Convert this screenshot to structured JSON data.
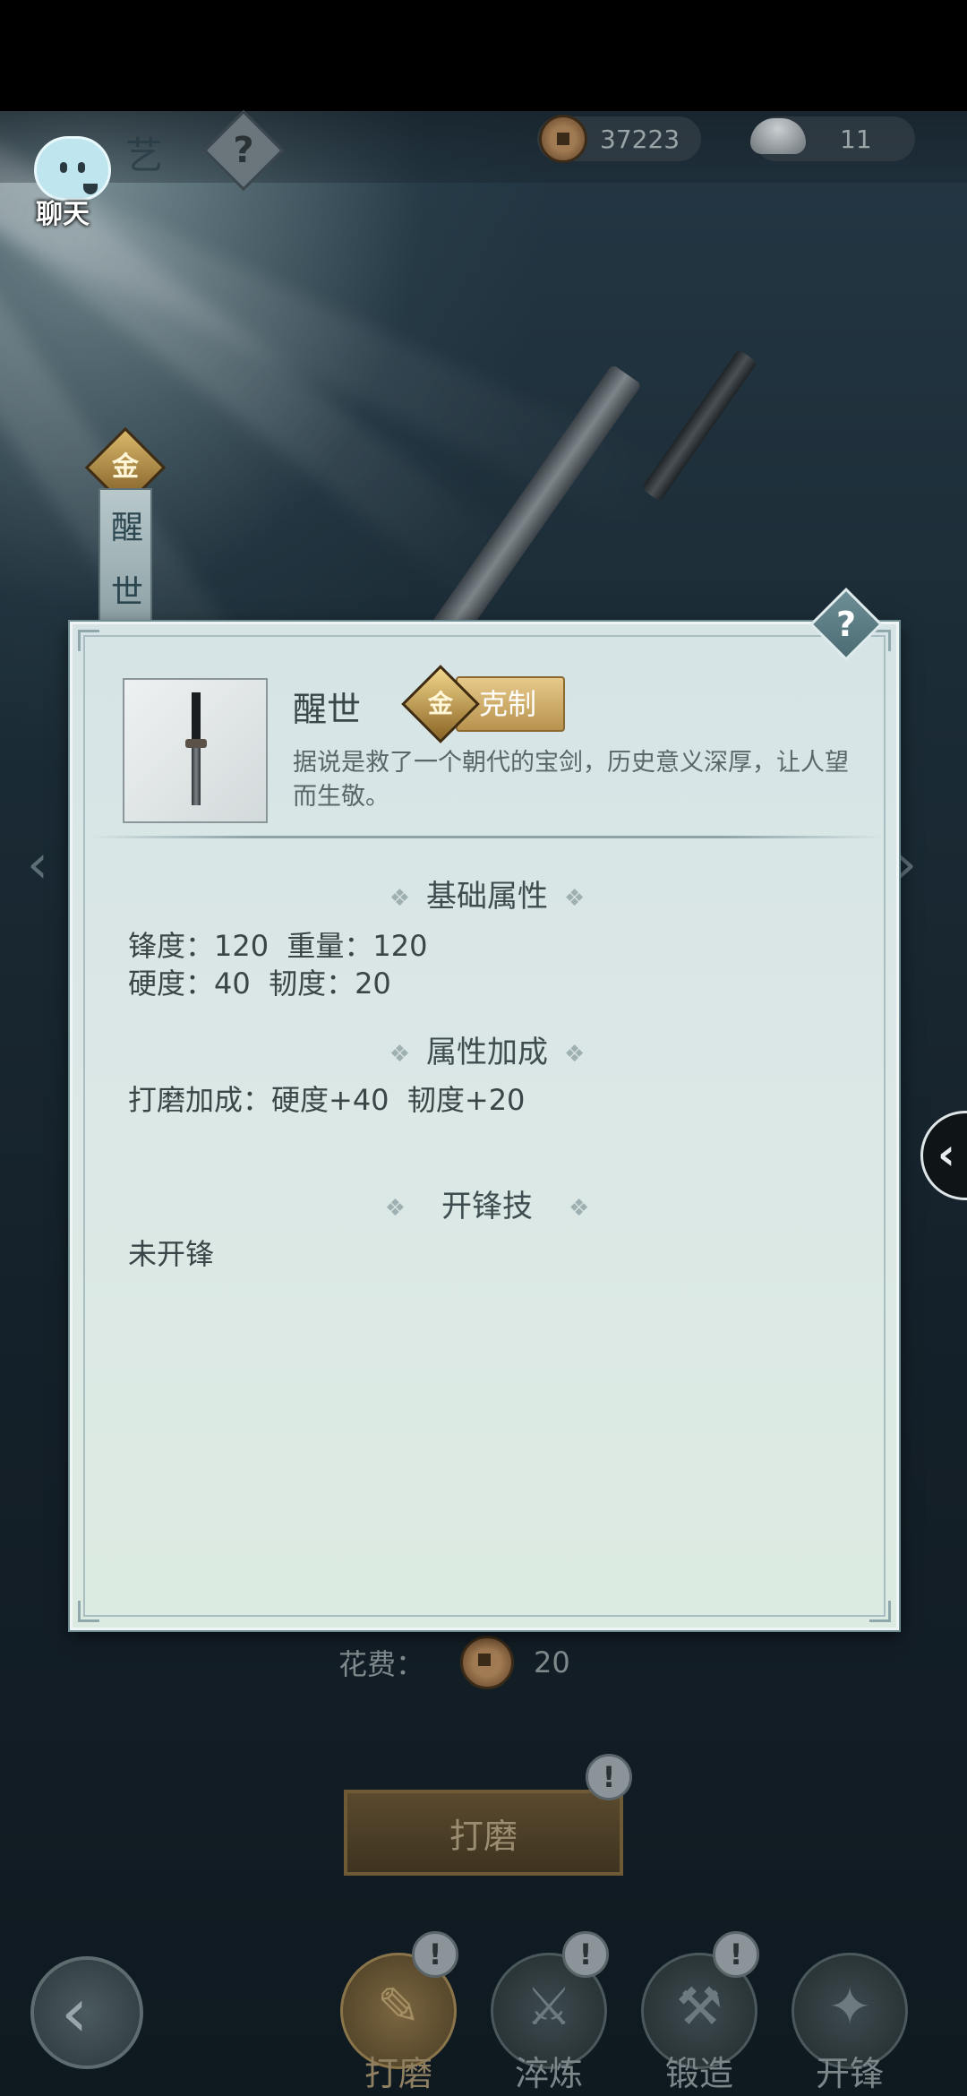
{
  "hud": {
    "title_fragment": "艺",
    "help_icon": "?",
    "copper_amount": "37223",
    "silver_amount": "11"
  },
  "chat": {
    "label": "聊天"
  },
  "side": {
    "badge_char": "金",
    "banner_chars": [
      "醒",
      "世"
    ]
  },
  "modal": {
    "help_icon": "?",
    "item_name": "醒世",
    "counter_badge_char": "金",
    "counter_label": "克制",
    "description": "据说是救了一个朝代的宝剑，历史意义深厚，让人望而生敬。",
    "sections": {
      "basic_title": "基础属性",
      "bonus_title": "属性加成",
      "skill_title": "开锋技"
    },
    "basic_stats": {
      "line1": "锋度：120  重量：120",
      "line2": "硬度：40  韧度：20"
    },
    "bonus_line": "打磨加成：硬度+40  韧度+20",
    "skill_line": "未开锋"
  },
  "cost": {
    "label": "花费：",
    "amount": "20"
  },
  "grind_button": {
    "label": "打磨",
    "alert": "!"
  },
  "tabs": [
    {
      "label": "打磨",
      "active": true,
      "alert": "!"
    },
    {
      "label": "淬炼",
      "active": false,
      "alert": "!"
    },
    {
      "label": "锻造",
      "active": false,
      "alert": "!"
    },
    {
      "label": "开锋",
      "active": false,
      "alert": ""
    }
  ],
  "nav": {
    "left_arrow": "‹",
    "right_arrow": "›",
    "pull_tab": "‹",
    "back": "‹"
  },
  "colors": {
    "modal_bg": "#d6e4e6",
    "gold_badge": "#d9b86a",
    "scene_bg": "#1b2b35"
  }
}
